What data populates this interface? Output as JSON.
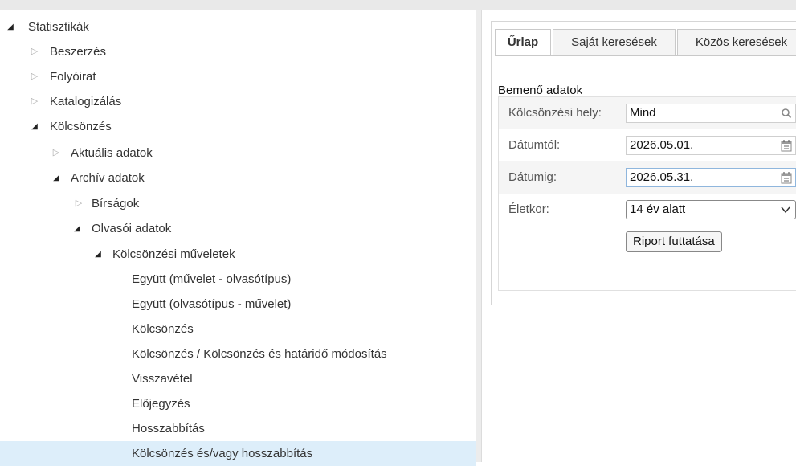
{
  "tree": [
    {
      "label": "Statisztikák",
      "state": "expanded"
    },
    {
      "label": "Beszerzés",
      "state": "collapsed"
    },
    {
      "label": "Folyóirat",
      "state": "collapsed"
    },
    {
      "label": "Katalogizálás",
      "state": "collapsed"
    },
    {
      "label": "Kölcsönzés",
      "state": "expanded"
    },
    {
      "label": "Aktuális adatok",
      "state": "collapsed"
    },
    {
      "label": "Archív adatok",
      "state": "expanded"
    },
    {
      "label": "Bírságok",
      "state": "collapsed"
    },
    {
      "label": "Olvasói adatok",
      "state": "expanded"
    },
    {
      "label": "Kölcsönzési műveletek",
      "state": "expanded"
    },
    {
      "label": "Együtt (művelet - olvasótípus)",
      "state": "leaf"
    },
    {
      "label": "Együtt (olvasótípus - művelet)",
      "state": "leaf"
    },
    {
      "label": "Kölcsönzés",
      "state": "leaf"
    },
    {
      "label": "Kölcsönzés / Kölcsönzés és határidő módosítás",
      "state": "leaf"
    },
    {
      "label": "Visszavétel",
      "state": "leaf"
    },
    {
      "label": "Előjegyzés",
      "state": "leaf"
    },
    {
      "label": "Hosszabbítás",
      "state": "leaf"
    },
    {
      "label": "Kölcsönzés és/vagy hosszabbítás",
      "state": "leaf",
      "selected": true
    }
  ],
  "tabs": [
    "Űrlap",
    "Saját keresések",
    "Közös keresések"
  ],
  "form": {
    "section_title": "Bemenő adatok",
    "location_label": "Kölcsönzési hely:",
    "location_value": "Mind",
    "date_from_label": "Dátumtól:",
    "date_from_value": "2026.05.01.",
    "date_to_label": "Dátumig:",
    "date_to_value": "2026.05.31.",
    "age_label": "Életkor:",
    "age_value": "14 év alatt",
    "run_button": "Riport futtatása"
  },
  "icons": {
    "expanded": "triangle-expanded-icon",
    "collapsed": "triangle-collapsed-icon",
    "search": "search-icon",
    "calendar": "calendar-icon",
    "dropdown": "chevron-down-icon"
  },
  "colors": {
    "selected_row": "#ddeefa",
    "field_focus": "#8fb6dd"
  }
}
